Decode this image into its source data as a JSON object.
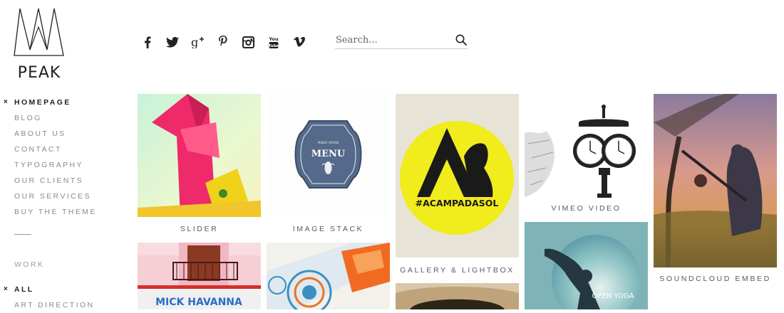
{
  "brand": {
    "logo_text": "PEAK"
  },
  "social": [
    {
      "icon": "facebook-icon"
    },
    {
      "icon": "twitter-icon"
    },
    {
      "icon": "google-plus-icon"
    },
    {
      "icon": "pinterest-icon"
    },
    {
      "icon": "instagram-icon"
    },
    {
      "icon": "youtube-icon"
    },
    {
      "icon": "vimeo-icon"
    }
  ],
  "search": {
    "placeholder": "Search..."
  },
  "nav": {
    "active_marker": "×",
    "items": [
      {
        "label": "HOMEPAGE",
        "active": true
      },
      {
        "label": "BLOG"
      },
      {
        "label": "ABOUT US"
      },
      {
        "label": "CONTACT"
      },
      {
        "label": "TYPOGRAPHY"
      },
      {
        "label": "OUR CLIENTS"
      },
      {
        "label": "OUR SERVICES"
      },
      {
        "label": "BUY THE THEME"
      }
    ]
  },
  "work": {
    "label": "WORK",
    "filters": [
      {
        "label": "ALL",
        "active": true
      },
      {
        "label": "ART DIRECTION"
      }
    ]
  },
  "portfolio": {
    "captions": {
      "slider": "SLIDER",
      "image_stack": "IMAGE STACK",
      "gallery": "GALLERY & LIGHTBOX",
      "vimeo": "VIMEO VIDEO",
      "soundcloud": "SOUNDCLOUD EMBED"
    },
    "artwork_text": {
      "menu_top": "PUBLIC HOUSE",
      "menu": "MENU",
      "hashtag": "#ACAMPADASOL",
      "sign": "MICK   HAVANNA",
      "yoga": "OPEN YOGA"
    }
  },
  "colors": {
    "accent_yellow": "#f1ec1c",
    "nav_active": "#222222",
    "nav_text": "#8a8a8a"
  }
}
